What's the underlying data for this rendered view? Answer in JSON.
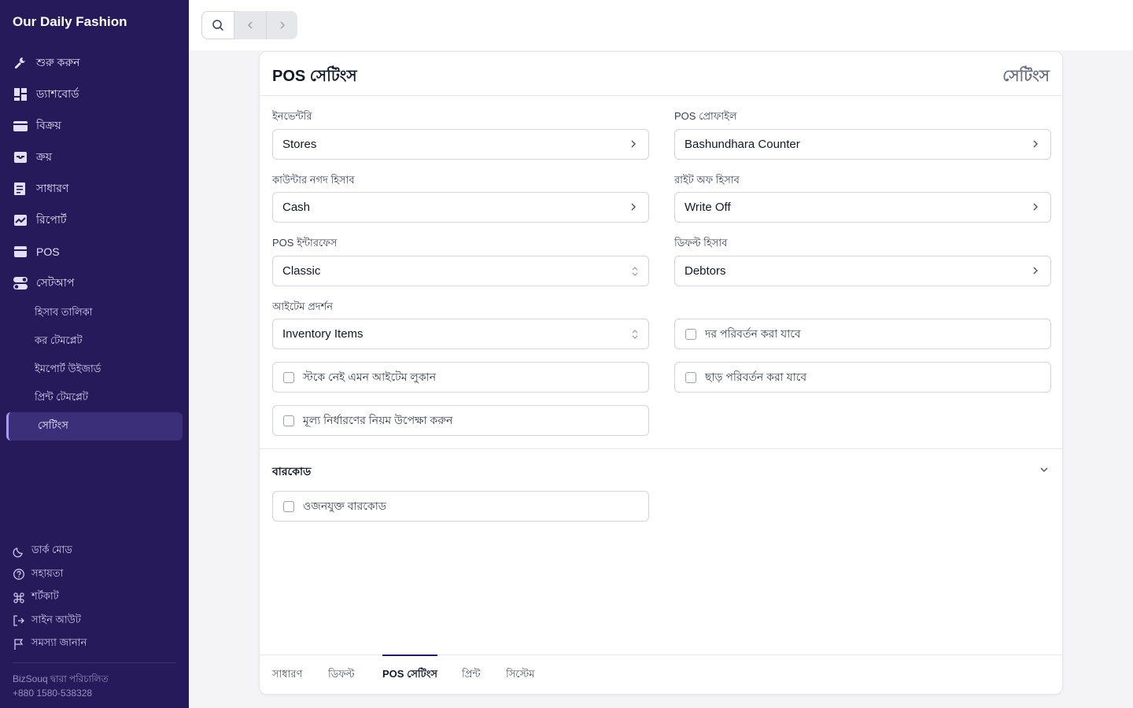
{
  "app": {
    "brand": "Our Daily Fashion"
  },
  "sidebar": {
    "items": [
      {
        "label": "শুরু করুন",
        "icon": "tools-icon"
      },
      {
        "label": "ড্যাশবোর্ড",
        "icon": "dashboard-icon"
      },
      {
        "label": "বিক্রয়",
        "icon": "card-icon"
      },
      {
        "label": "ক্রয়",
        "icon": "inbox-icon"
      },
      {
        "label": "সাধারণ",
        "icon": "journal-icon"
      },
      {
        "label": "রিপোর্ট",
        "icon": "chart-icon"
      },
      {
        "label": "POS",
        "icon": "pos-icon"
      },
      {
        "label": "সেটআপ",
        "icon": "toggle-icon"
      }
    ],
    "subitems": [
      {
        "label": "হিসাব তালিকা"
      },
      {
        "label": "কর টেমপ্লেট"
      },
      {
        "label": "ইমপোর্ট উইজার্ড"
      },
      {
        "label": "প্রিন্ট টেমপ্লেট"
      },
      {
        "label": "সেটিংস"
      }
    ],
    "bottom": [
      {
        "label": "ডার্ক মোড",
        "icon": "moon-icon"
      },
      {
        "label": "সহায়তা",
        "icon": "help-icon"
      },
      {
        "label": "শর্টকাট",
        "icon": "command-icon"
      },
      {
        "label": "সাইন আউট",
        "icon": "sign-out-icon"
      },
      {
        "label": "সমস্যা জানান",
        "icon": "flag-icon"
      }
    ],
    "footer_line1": "BizSouq দ্বারা পরিচালিত",
    "footer_line2": "+880 1580-538328"
  },
  "card": {
    "title": "POS সেটিংস",
    "right_title": "সেটিংস",
    "fields": {
      "inventory": {
        "label": "ইনভেন্টরি",
        "value": "Stores"
      },
      "pos_profile": {
        "label": "POS প্রোফাইল",
        "value": "Bashundhara Counter"
      },
      "counter_cash": {
        "label": "কাউন্টার নগদ হিসাব",
        "value": "Cash"
      },
      "write_off": {
        "label": "রাইট অফ হিসাব",
        "value": "Write Off"
      },
      "pos_interface": {
        "label": "POS ইন্টারফেস",
        "value": "Classic"
      },
      "default_account": {
        "label": "ডিফল্ট হিসাব",
        "value": "Debtors"
      },
      "item_display": {
        "label": "আইটেম প্রদর্শন",
        "value": "Inventory Items"
      }
    },
    "checks": {
      "rate_change": "দর পরিবর্তন করা যাবে",
      "hide_out_of_stock": "স্টকে নেই এমন আইটেম লুকান",
      "discount_change": "ছাড় পরিবর্তন করা যাবে",
      "ignore_pricing_rule": "মূল্য নির্ধারণের নিয়ম উপেক্ষা করুন",
      "weighted_barcode": "ওজনযুক্ত বারকোড"
    },
    "barcode_section": "বারকোড",
    "tabs": [
      {
        "label": "সাধারণ"
      },
      {
        "label": "ডিফল্ট"
      },
      {
        "label": "POS সেটিংস"
      },
      {
        "label": "প্রিন্ট"
      },
      {
        "label": "সিস্টেম"
      }
    ]
  }
}
